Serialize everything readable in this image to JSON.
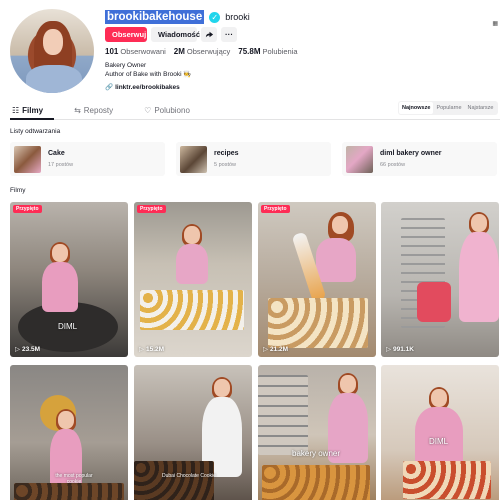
{
  "profile": {
    "username": "brookibakehouse",
    "nickname": "brooki",
    "follow_label": "Obserwuj",
    "message_label": "Wiadomość",
    "stats": [
      {
        "value": "101",
        "label": "Obserwowani"
      },
      {
        "value": "2M",
        "label": "Obserwujący"
      },
      {
        "value": "75.8M",
        "label": "Polubienia"
      }
    ],
    "bio_line1": "Bakery Owner",
    "bio_line2": "Author of Bake with Brooki 🧑‍🍳",
    "link": "linktr.ee/brookibakes"
  },
  "tabs": [
    {
      "label": "Filmy",
      "icon": "grid-icon"
    },
    {
      "label": "Reposty",
      "icon": "repost-icon"
    },
    {
      "label": "Polubiono",
      "icon": "heart-outline-icon"
    }
  ],
  "sort_options": [
    "Najnowsze",
    "Popularne",
    "Najstarsze"
  ],
  "playlists_title": "Listy odtwarzania",
  "playlists": [
    {
      "name": "Cake",
      "count": "17 postów"
    },
    {
      "name": "recipes",
      "count": "5 postów"
    },
    {
      "name": "diml bakery owner",
      "count": "66 postów"
    }
  ],
  "videos_title": "Filmy",
  "videos": [
    {
      "badge": "Przypięto",
      "views": "23.5M",
      "caption": "DIML"
    },
    {
      "badge": "Przypięto",
      "views": "15.2M",
      "caption": ""
    },
    {
      "badge": "Przypięto",
      "views": "21.2M",
      "caption": ""
    },
    {
      "badge": "",
      "views": "991.1K",
      "caption": ""
    },
    {
      "badge": "",
      "views": "",
      "caption": "the most popular cookie"
    },
    {
      "badge": "",
      "views": "",
      "caption": "Dubai Chocolate Cookie"
    },
    {
      "badge": "",
      "views": "",
      "caption": "bakery owner"
    },
    {
      "badge": "",
      "views": "",
      "caption": "DIML"
    }
  ],
  "colors": {
    "accent": "#fe2c55",
    "verified": "#20d5ec",
    "text": "#161823",
    "muted": "#73747b"
  }
}
